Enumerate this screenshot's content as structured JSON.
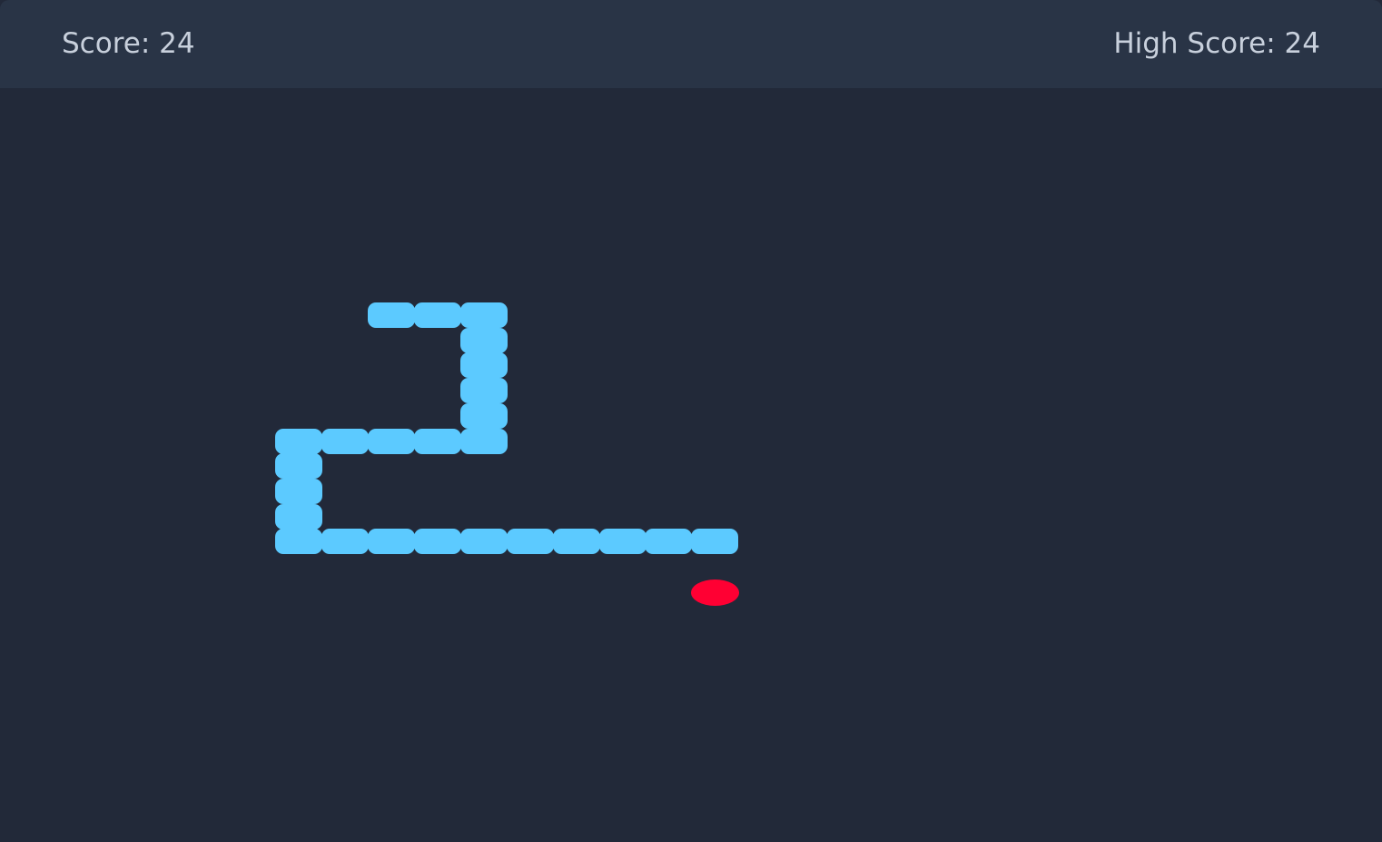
{
  "header": {
    "score_text": "Score: 24",
    "high_score_text": "High Score: 24"
  },
  "game": {
    "score": 24,
    "high_score": 24,
    "colors": {
      "snake": "#5ccaff",
      "food": "#ff0033",
      "board": "#222939",
      "header": "#293446",
      "text": "#c8d0dc"
    },
    "snake_cells": [
      [
        8,
        16
      ],
      [
        9,
        16
      ],
      [
        10,
        16
      ],
      [
        10,
        17
      ],
      [
        10,
        18
      ],
      [
        10,
        19
      ],
      [
        10,
        20
      ],
      [
        10,
        21
      ],
      [
        9,
        21
      ],
      [
        8,
        21
      ],
      [
        7,
        21
      ],
      [
        6,
        21
      ],
      [
        6,
        22
      ],
      [
        6,
        23
      ],
      [
        6,
        24
      ],
      [
        6,
        25
      ],
      [
        7,
        25
      ],
      [
        8,
        25
      ],
      [
        9,
        25
      ],
      [
        10,
        25
      ],
      [
        11,
        25
      ],
      [
        12,
        25
      ],
      [
        13,
        25
      ],
      [
        14,
        25
      ],
      [
        15,
        25
      ]
    ],
    "food_cell": [
      15,
      27
    ]
  }
}
